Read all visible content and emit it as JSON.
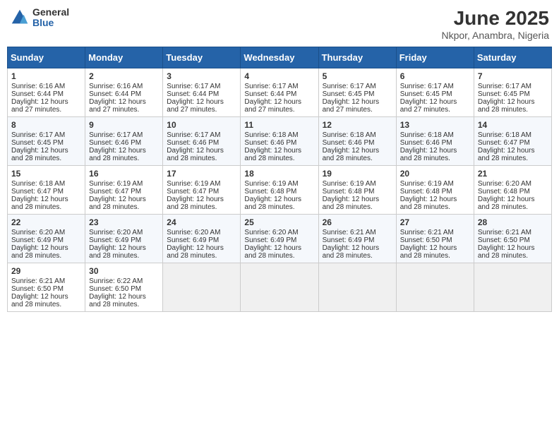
{
  "logo": {
    "general": "General",
    "blue": "Blue"
  },
  "title": "June 2025",
  "subtitle": "Nkpor, Anambra, Nigeria",
  "days": [
    "Sunday",
    "Monday",
    "Tuesday",
    "Wednesday",
    "Thursday",
    "Friday",
    "Saturday"
  ],
  "weeks": [
    [
      {
        "day": "1",
        "sunrise": "Sunrise: 6:16 AM",
        "sunset": "Sunset: 6:44 PM",
        "daylight": "Daylight: 12 hours and 27 minutes."
      },
      {
        "day": "2",
        "sunrise": "Sunrise: 6:16 AM",
        "sunset": "Sunset: 6:44 PM",
        "daylight": "Daylight: 12 hours and 27 minutes."
      },
      {
        "day": "3",
        "sunrise": "Sunrise: 6:17 AM",
        "sunset": "Sunset: 6:44 PM",
        "daylight": "Daylight: 12 hours and 27 minutes."
      },
      {
        "day": "4",
        "sunrise": "Sunrise: 6:17 AM",
        "sunset": "Sunset: 6:44 PM",
        "daylight": "Daylight: 12 hours and 27 minutes."
      },
      {
        "day": "5",
        "sunrise": "Sunrise: 6:17 AM",
        "sunset": "Sunset: 6:45 PM",
        "daylight": "Daylight: 12 hours and 27 minutes."
      },
      {
        "day": "6",
        "sunrise": "Sunrise: 6:17 AM",
        "sunset": "Sunset: 6:45 PM",
        "daylight": "Daylight: 12 hours and 27 minutes."
      },
      {
        "day": "7",
        "sunrise": "Sunrise: 6:17 AM",
        "sunset": "Sunset: 6:45 PM",
        "daylight": "Daylight: 12 hours and 28 minutes."
      }
    ],
    [
      {
        "day": "8",
        "sunrise": "Sunrise: 6:17 AM",
        "sunset": "Sunset: 6:45 PM",
        "daylight": "Daylight: 12 hours and 28 minutes."
      },
      {
        "day": "9",
        "sunrise": "Sunrise: 6:17 AM",
        "sunset": "Sunset: 6:46 PM",
        "daylight": "Daylight: 12 hours and 28 minutes."
      },
      {
        "day": "10",
        "sunrise": "Sunrise: 6:17 AM",
        "sunset": "Sunset: 6:46 PM",
        "daylight": "Daylight: 12 hours and 28 minutes."
      },
      {
        "day": "11",
        "sunrise": "Sunrise: 6:18 AM",
        "sunset": "Sunset: 6:46 PM",
        "daylight": "Daylight: 12 hours and 28 minutes."
      },
      {
        "day": "12",
        "sunrise": "Sunrise: 6:18 AM",
        "sunset": "Sunset: 6:46 PM",
        "daylight": "Daylight: 12 hours and 28 minutes."
      },
      {
        "day": "13",
        "sunrise": "Sunrise: 6:18 AM",
        "sunset": "Sunset: 6:46 PM",
        "daylight": "Daylight: 12 hours and 28 minutes."
      },
      {
        "day": "14",
        "sunrise": "Sunrise: 6:18 AM",
        "sunset": "Sunset: 6:47 PM",
        "daylight": "Daylight: 12 hours and 28 minutes."
      }
    ],
    [
      {
        "day": "15",
        "sunrise": "Sunrise: 6:18 AM",
        "sunset": "Sunset: 6:47 PM",
        "daylight": "Daylight: 12 hours and 28 minutes."
      },
      {
        "day": "16",
        "sunrise": "Sunrise: 6:19 AM",
        "sunset": "Sunset: 6:47 PM",
        "daylight": "Daylight: 12 hours and 28 minutes."
      },
      {
        "day": "17",
        "sunrise": "Sunrise: 6:19 AM",
        "sunset": "Sunset: 6:47 PM",
        "daylight": "Daylight: 12 hours and 28 minutes."
      },
      {
        "day": "18",
        "sunrise": "Sunrise: 6:19 AM",
        "sunset": "Sunset: 6:48 PM",
        "daylight": "Daylight: 12 hours and 28 minutes."
      },
      {
        "day": "19",
        "sunrise": "Sunrise: 6:19 AM",
        "sunset": "Sunset: 6:48 PM",
        "daylight": "Daylight: 12 hours and 28 minutes."
      },
      {
        "day": "20",
        "sunrise": "Sunrise: 6:19 AM",
        "sunset": "Sunset: 6:48 PM",
        "daylight": "Daylight: 12 hours and 28 minutes."
      },
      {
        "day": "21",
        "sunrise": "Sunrise: 6:20 AM",
        "sunset": "Sunset: 6:48 PM",
        "daylight": "Daylight: 12 hours and 28 minutes."
      }
    ],
    [
      {
        "day": "22",
        "sunrise": "Sunrise: 6:20 AM",
        "sunset": "Sunset: 6:49 PM",
        "daylight": "Daylight: 12 hours and 28 minutes."
      },
      {
        "day": "23",
        "sunrise": "Sunrise: 6:20 AM",
        "sunset": "Sunset: 6:49 PM",
        "daylight": "Daylight: 12 hours and 28 minutes."
      },
      {
        "day": "24",
        "sunrise": "Sunrise: 6:20 AM",
        "sunset": "Sunset: 6:49 PM",
        "daylight": "Daylight: 12 hours and 28 minutes."
      },
      {
        "day": "25",
        "sunrise": "Sunrise: 6:20 AM",
        "sunset": "Sunset: 6:49 PM",
        "daylight": "Daylight: 12 hours and 28 minutes."
      },
      {
        "day": "26",
        "sunrise": "Sunrise: 6:21 AM",
        "sunset": "Sunset: 6:49 PM",
        "daylight": "Daylight: 12 hours and 28 minutes."
      },
      {
        "day": "27",
        "sunrise": "Sunrise: 6:21 AM",
        "sunset": "Sunset: 6:50 PM",
        "daylight": "Daylight: 12 hours and 28 minutes."
      },
      {
        "day": "28",
        "sunrise": "Sunrise: 6:21 AM",
        "sunset": "Sunset: 6:50 PM",
        "daylight": "Daylight: 12 hours and 28 minutes."
      }
    ],
    [
      {
        "day": "29",
        "sunrise": "Sunrise: 6:21 AM",
        "sunset": "Sunset: 6:50 PM",
        "daylight": "Daylight: 12 hours and 28 minutes."
      },
      {
        "day": "30",
        "sunrise": "Sunrise: 6:22 AM",
        "sunset": "Sunset: 6:50 PM",
        "daylight": "Daylight: 12 hours and 28 minutes."
      },
      null,
      null,
      null,
      null,
      null
    ]
  ]
}
